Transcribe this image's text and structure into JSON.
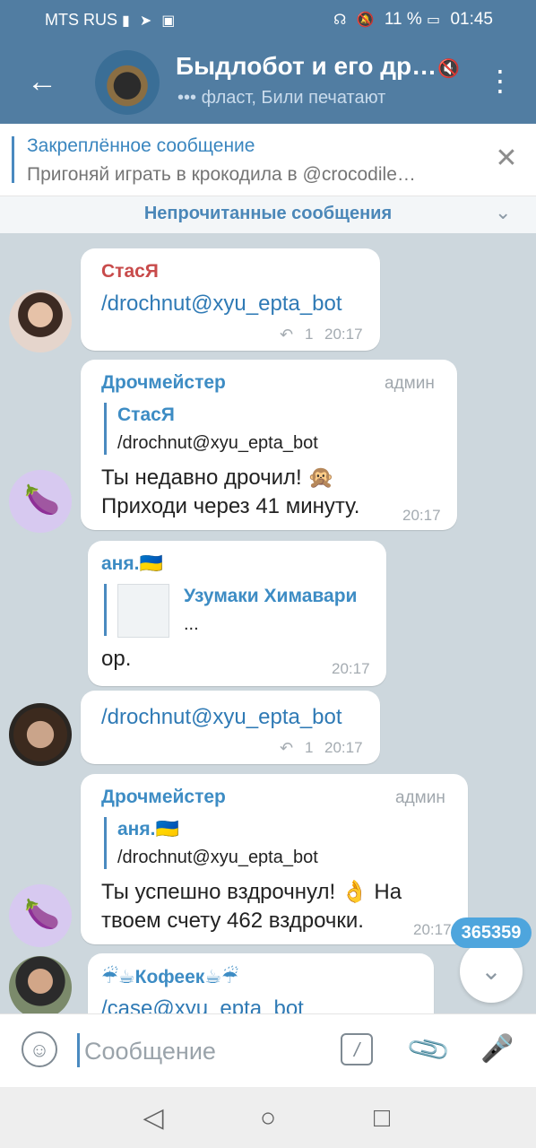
{
  "status_bar": {
    "carrier": "MTS RUS",
    "battery": "11 %",
    "time": "01:45",
    "icons": [
      "signal-icon",
      "telegram-icon",
      "instagram-icon",
      "headphones-icon",
      "bell-off-icon",
      "battery-icon"
    ]
  },
  "header": {
    "title": "Быдлобот и его др…",
    "status": "••• фласт, Били печатают",
    "back_icon": "arrow-left-icon",
    "menu_icon": "kebab-menu-icon",
    "mute_icon": "muted-icon"
  },
  "pinned": {
    "title": "Закреплённое сообщение",
    "text": "Пригоняй играть в крокодила в @crocodile…"
  },
  "unread_bar": {
    "label": "Непрочитанные сообщения"
  },
  "colors": {
    "header": "#517da2",
    "link": "#2f7ab5",
    "accent": "#4a8ac0",
    "sender_red": "#c84b4b",
    "sender_blue": "#3d8cc4"
  },
  "messages": [
    {
      "sender": "СтасЯ",
      "text": "/drochnut@xyu_epta_bot",
      "replies": "1",
      "time": "20:17"
    },
    {
      "sender": "Дрочмейстер",
      "role": "админ",
      "quote_name": "СтасЯ",
      "quote_text": "/drochnut@xyu_epta_bot",
      "text_line1": "Ты недавно дрочил! 🙊",
      "text_line2": "Приходи через 41 минуту.",
      "time": "20:17"
    },
    {
      "sender": "аня.🇺🇦",
      "quote_name": "Узумаки Химавари",
      "quote_text": "...",
      "text": "ор.",
      "time": "20:17"
    },
    {
      "text": "/drochnut@xyu_epta_bot",
      "replies": "1",
      "time": "20:17"
    },
    {
      "sender": "Дрочмейстер",
      "role": "админ",
      "quote_name": "аня.🇺🇦",
      "quote_text": "/drochnut@xyu_epta_bot",
      "text_line1": "Ты успешно вздрочнул! 👌 На",
      "text_line2": "твоем счету 462 вздрочки.",
      "time": "20:17"
    },
    {
      "sender": "☔☕Кофеек☕☔",
      "text": "/case@xyu_epta_bot"
    }
  ],
  "unread_counter": "365359",
  "input": {
    "placeholder": "Сообщение",
    "value": ""
  },
  "input_icons": [
    "emoji-icon",
    "bot-command-icon",
    "paperclip-icon",
    "microphone-icon"
  ],
  "nav_icons": [
    "back-triangle-icon",
    "home-circle-icon",
    "recents-square-icon"
  ]
}
